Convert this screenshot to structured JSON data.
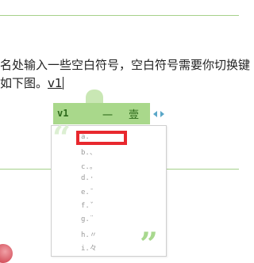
{
  "editor": {
    "line1": "名处输入一些空白符号，空白符号需要你切换键",
    "line2_prefix": "如下图。",
    "typed": "v1"
  },
  "ime": {
    "composition": "v1",
    "candidates": [
      "一",
      "壹"
    ]
  },
  "punctuation_options": [
    "a.",
    "b.、",
    "c.。",
    "d.·",
    "e.ˉ",
    "f.ˇ",
    "g.¨",
    "h.〃",
    "i.々"
  ]
}
